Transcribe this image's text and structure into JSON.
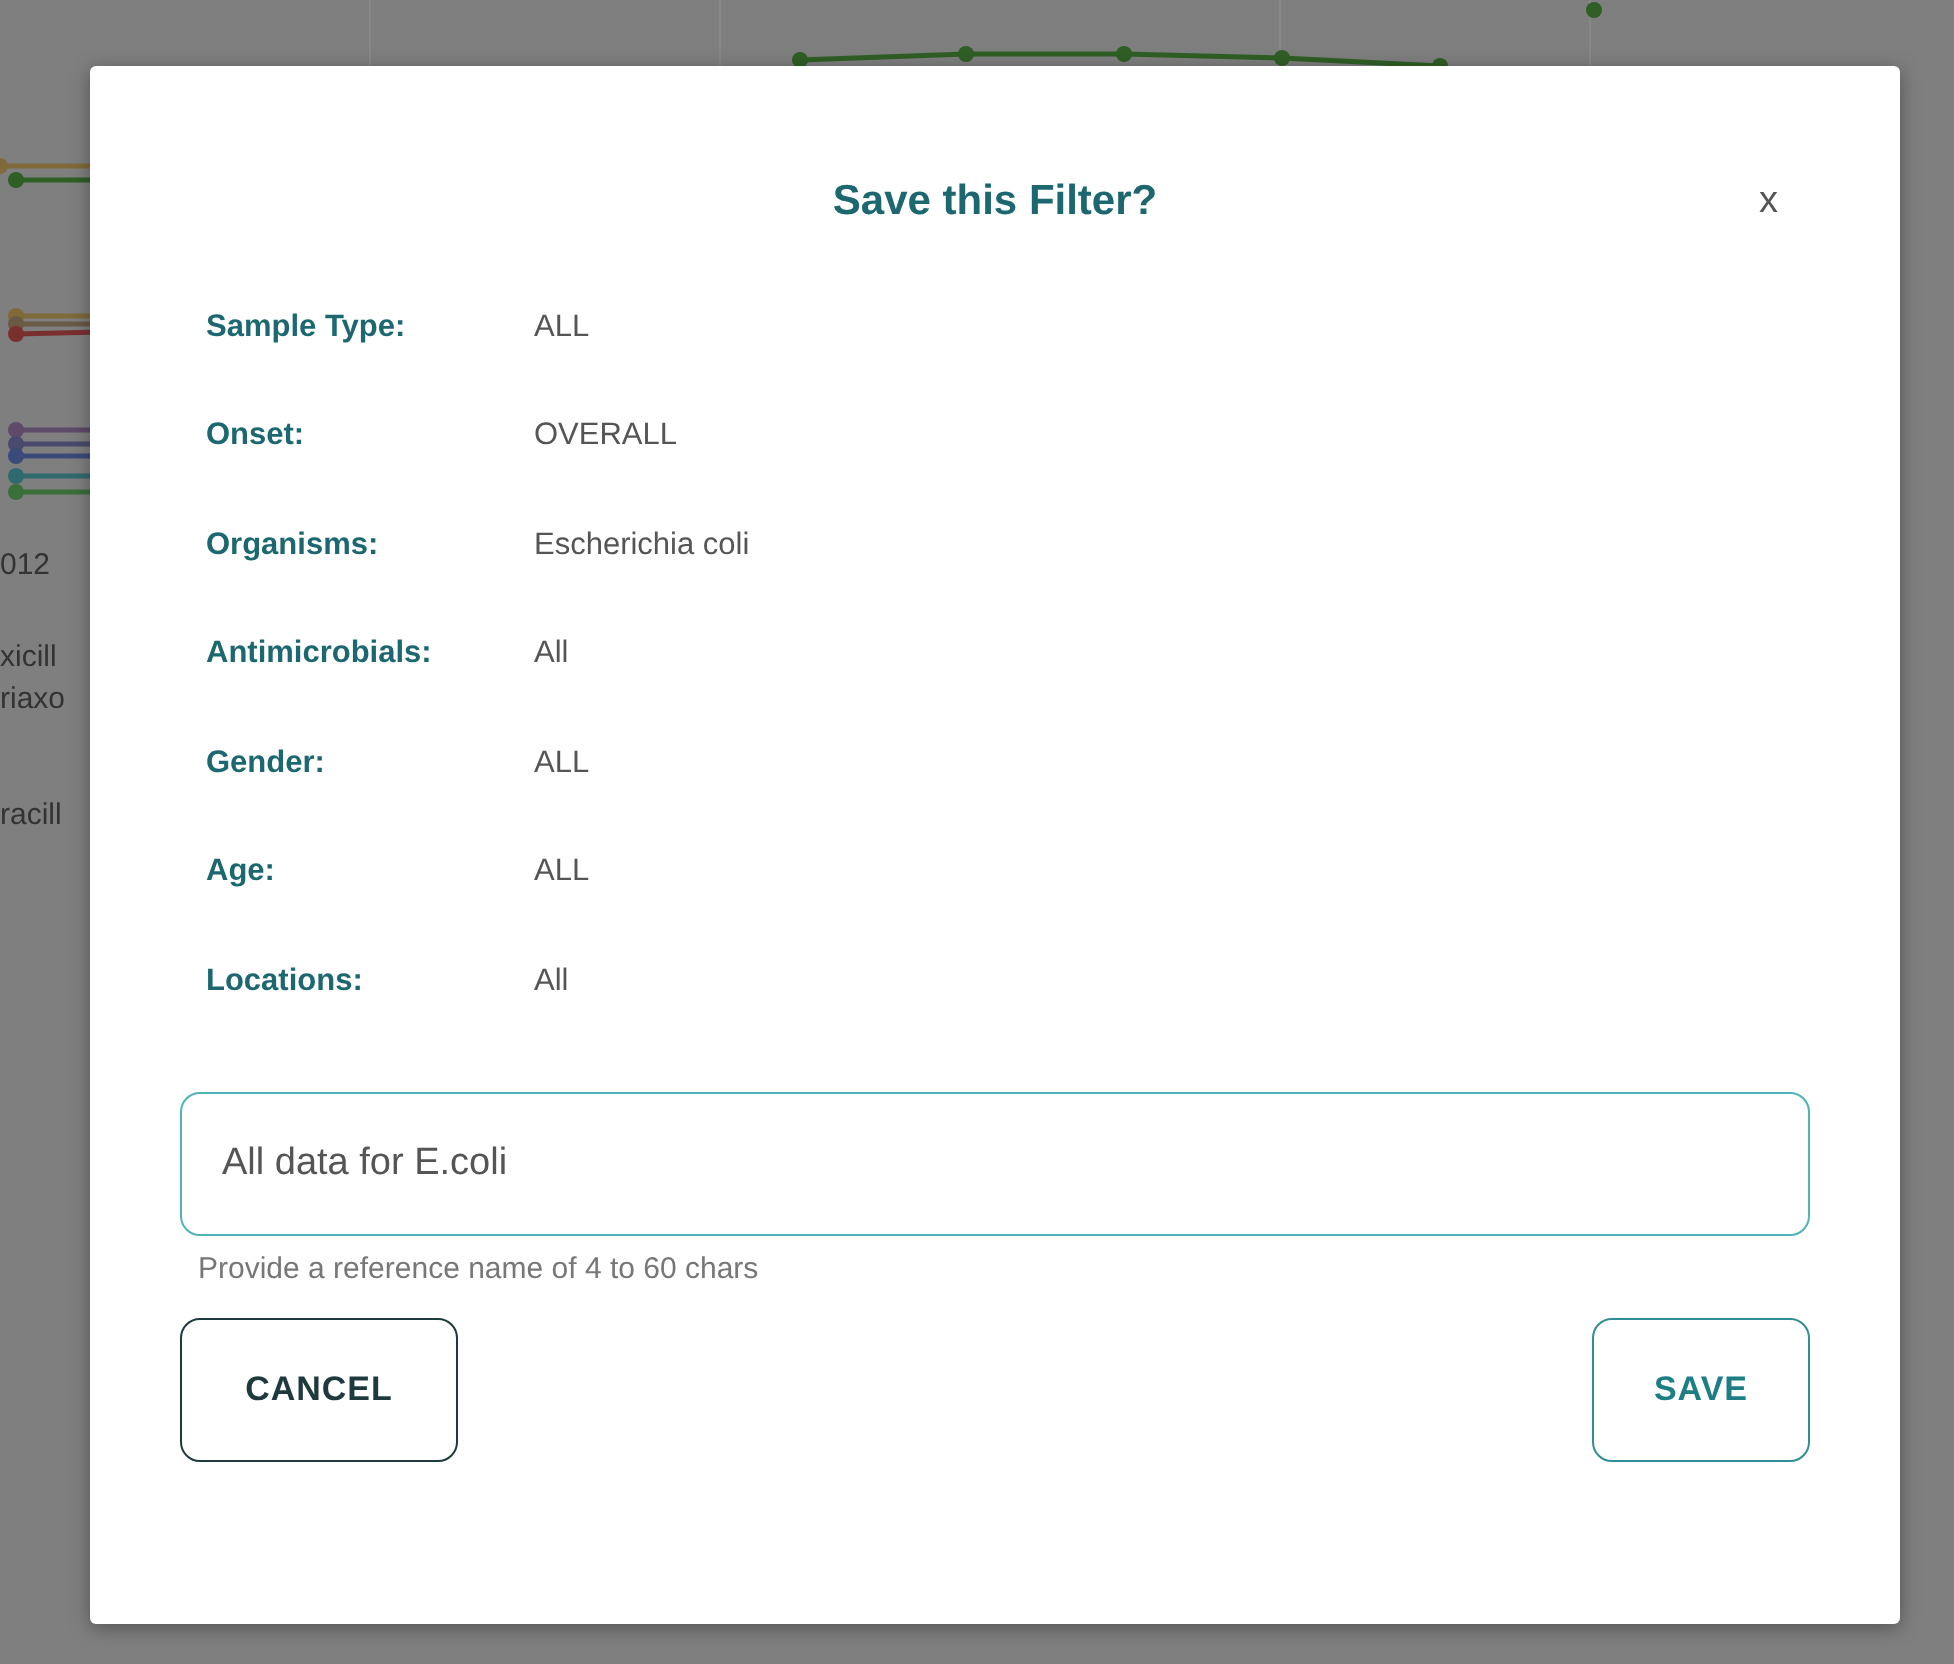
{
  "background": {
    "axis_label": "012",
    "legend_texts": [
      "xicill",
      "riaxo",
      "racill"
    ]
  },
  "dialog": {
    "title": "Save this Filter?",
    "close": "x",
    "fields": [
      {
        "label": "Sample Type:",
        "value": "ALL"
      },
      {
        "label": "Onset:",
        "value": "OVERALL"
      },
      {
        "label": "Organisms:",
        "value": "Escherichia coli"
      },
      {
        "label": "Antimicrobials:",
        "value": "All"
      },
      {
        "label": "Gender:",
        "value": "ALL"
      },
      {
        "label": "Age:",
        "value": "ALL"
      },
      {
        "label": "Locations:",
        "value": "All"
      }
    ],
    "name_input": {
      "value": "All data for E.coli"
    },
    "hint": "Provide a reference name of 4 to 60 chars",
    "buttons": [
      {
        "label": "CANCEL",
        "kind": "cancel"
      },
      {
        "label": "SAVE",
        "kind": "save"
      }
    ]
  }
}
